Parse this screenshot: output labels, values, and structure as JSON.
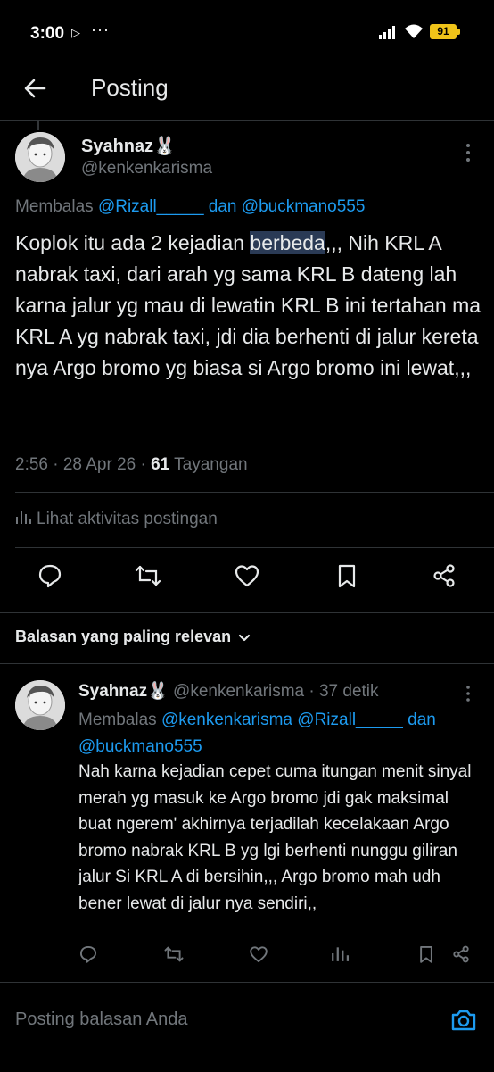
{
  "status_bar": {
    "time": "3:00",
    "play_icon": "▷",
    "dots": "···",
    "battery": "91",
    "battery_color": "#f0c419"
  },
  "header": {
    "title": "Posting",
    "back_icon": "arrow-left-icon"
  },
  "main_post": {
    "author_name": "Syahnaz🐰",
    "handle": "@kenkenkarisma",
    "replying_label": "Membalas",
    "replying_user1": "@Rizall_____",
    "replying_and": "dan",
    "replying_user2": "@buckmano555",
    "text_before_highlight": "Koplok itu ada 2 kejadian ",
    "text_highlight": "berbeda",
    "text_after_highlight": ",,, Nih KRL A nabrak taxi, dari arah yg sama KRL B dateng lah karna jalur yg mau di lewatin KRL B ini tertahan ma KRL A yg nabrak taxi, jdi dia berhenti di jalur kereta nya Argo bromo yg biasa si Argo bromo ini lewat,,,",
    "timestamp": "2:56 · 28 Apr 26 · ",
    "views_count": "61",
    "views_label": "Tayangan",
    "activity_label": "Lihat aktivitas postingan"
  },
  "sort": {
    "label": "Balasan yang paling relevan"
  },
  "reply": {
    "author_name": "Syahnaz🐰",
    "handle_time": "@kenkenkarisma · 37 detik",
    "replying_label": "Membalas",
    "replying_user1": "@kenkenkarisma",
    "replying_user2": "@Rizall_____",
    "replying_and": "dan",
    "replying_user3": "@buckmano555",
    "text": "Nah karna kejadian cepet cuma itungan menit sinyal merah yg masuk ke Argo bromo jdi gak maksimal buat ngerem' akhirnya terjadilah kecelakaan Argo bromo nabrak KRL B yg lgi berhenti nunggu giliran jalur Si KRL A di bersihin,,, Argo bromo mah udh bener lewat di jalur nya sendiri,,"
  },
  "compose": {
    "placeholder": "Posting balasan Anda"
  },
  "colors": {
    "background": "#000000",
    "text": "#e7e9ea",
    "secondary": "#71767b",
    "link": "#1d9bf0",
    "divider": "#2f3336"
  }
}
